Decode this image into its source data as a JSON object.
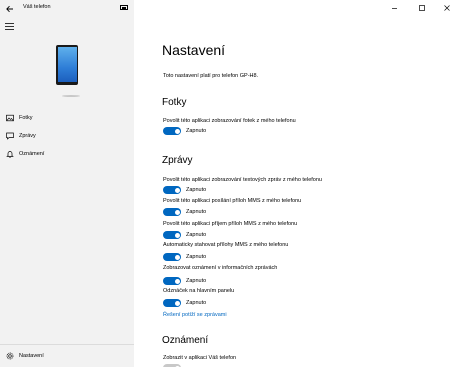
{
  "app": {
    "title": "Váš telefon"
  },
  "sidebar": {
    "items": [
      {
        "label": "Fotky",
        "icon": "photo-icon"
      },
      {
        "label": "Zprávy",
        "icon": "message-icon"
      },
      {
        "label": "Oznámení",
        "icon": "bell-icon"
      }
    ],
    "settings_label": "Nastavení"
  },
  "main": {
    "title": "Nastavení",
    "subtitle": "Toto nastavení platí pro telefon GP-H8.",
    "sections": {
      "photos": {
        "title": "Fotky",
        "settings": [
          {
            "label": "Povolit této aplikaci zobrazování fotek z mého telefonu",
            "state": "Zapnuto",
            "on": true
          }
        ]
      },
      "messages": {
        "title": "Zprávy",
        "settings": [
          {
            "label": "Povolit této aplikaci zobrazování textových zpráv z mého telefonu",
            "state": "Zapnuto",
            "on": true
          },
          {
            "label": "Povolit této aplikaci posílání příloh MMS z mého telefonu",
            "state": "Zapnuto",
            "on": true
          },
          {
            "label": "Povolit této aplikaci příjem příloh MMS z mého telefonu",
            "state": "Zapnuto",
            "on": true
          },
          {
            "label": "Automaticky stahovat přílohy MMS z mého telefonu",
            "state": "Zapnuto",
            "on": true
          },
          {
            "label": "Zobrazovat oznámení v informačních zprávách",
            "state": "Zapnuto",
            "on": true
          },
          {
            "label": "Odznáček na hlavním panelu",
            "state": "Zapnuto",
            "on": true
          }
        ],
        "link": "Řešení potíží se zprávami"
      },
      "notifications": {
        "title": "Oznámení",
        "settings": [
          {
            "label": "Zobrazit v aplikaci Váš telefon"
          }
        ]
      }
    }
  },
  "colors": {
    "accent": "#0067c0",
    "sidebar_bg": "#f2f2f2"
  }
}
